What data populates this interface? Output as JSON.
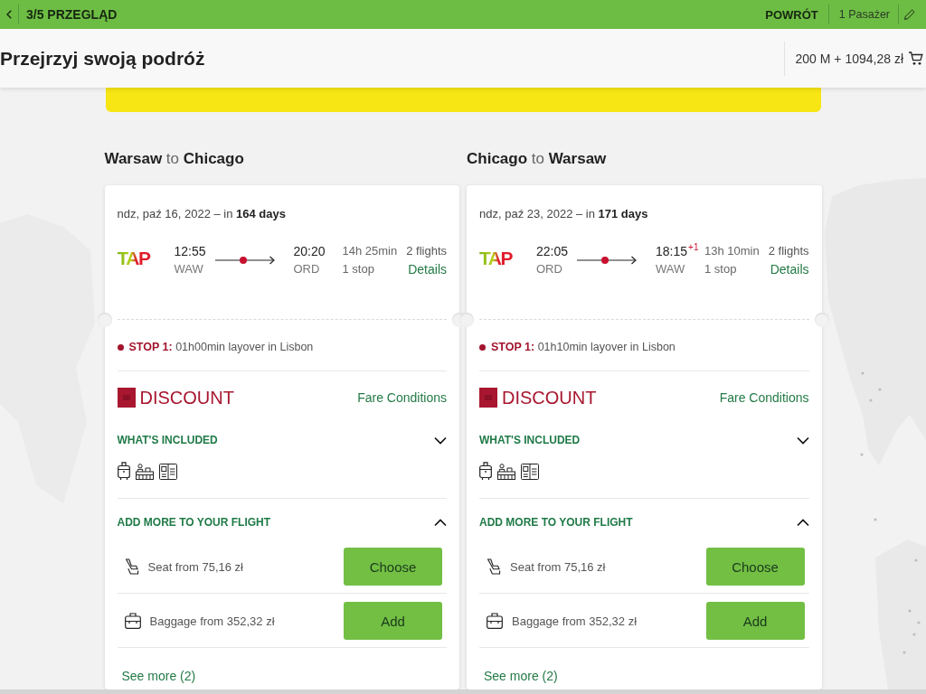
{
  "top_bar": {
    "step": "3/5 PRZEGLĄD",
    "return_link": "POWRÓT",
    "passengers": "1 Pasażer"
  },
  "header": {
    "title": "Przejrzyj swoją podróż",
    "total": "200 M + 1094,28 zł"
  },
  "journeys": [
    {
      "heading": "**Warsaw** to **Chicago**",
      "date": "ndz, paź 16, 2022 – in **164 days**",
      "airline": "TAP",
      "departure": {
        "time": "12:55",
        "airport": "WAW"
      },
      "arrival": {
        "time": "20:20",
        "airport": "ORD"
      },
      "duration": "14h 25min",
      "stops": "1 stop",
      "flights": "2 flights",
      "details_link": "Details",
      "stop_info": "**STOP 1:** 01h00min layover in Lisbon",
      "fare": {
        "name": "DISCOUNT",
        "conditions_link": "Fare Conditions"
      },
      "included": {
        "title": "WHAT'S INCLUDED",
        "expanded": false
      },
      "extras": {
        "title": "ADD MORE TO YOUR FLIGHT",
        "expanded": true,
        "items": [
          {
            "kind": "seat",
            "text": "Seat from 75,16 zł",
            "button": "Choose"
          },
          {
            "kind": "baggage",
            "text": "Baggage from 352,32 zł",
            "button": "Add"
          }
        ],
        "see_more": "See more (2)"
      }
    },
    {
      "heading": "**Chicago** to **Warsaw**",
      "date": "ndz, paź 23, 2022 – in **171 days**",
      "airline": "TAP",
      "departure": {
        "time": "22:05",
        "airport": "ORD"
      },
      "arrival": {
        "time": "18:15",
        "day_offset": "+1",
        "airport": "WAW"
      },
      "duration": "13h 10min",
      "stops": "1 stop",
      "flights": "2 flights",
      "details_link": "Details",
      "stop_info": "**STOP 1:** 01h10min layover in Lisbon",
      "fare": {
        "name": "DISCOUNT",
        "conditions_link": "Fare Conditions"
      },
      "included": {
        "title": "WHAT'S INCLUDED",
        "expanded": false
      },
      "extras": {
        "title": "ADD MORE TO YOUR FLIGHT",
        "expanded": true,
        "items": [
          {
            "kind": "seat",
            "text": "Seat from 75,16 zł",
            "button": "Choose"
          },
          {
            "kind": "baggage",
            "text": "Baggage from 352,32 zł",
            "button": "Add"
          }
        ],
        "see_more": "See more (2)"
      }
    }
  ]
}
